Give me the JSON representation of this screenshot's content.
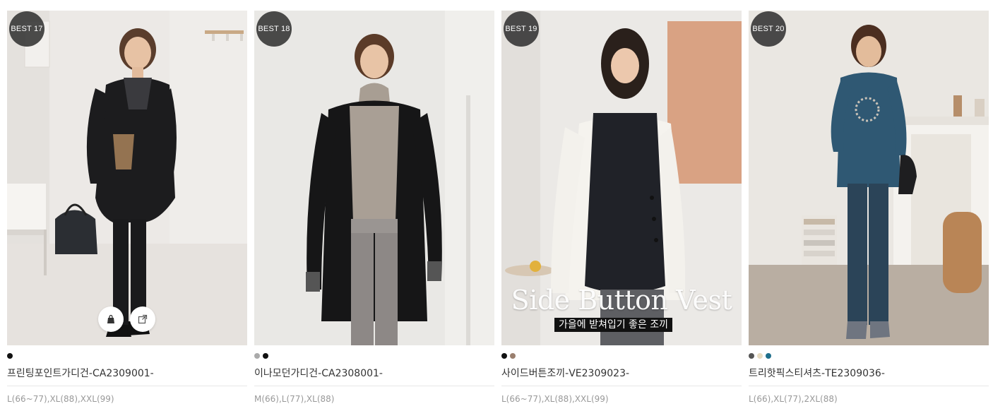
{
  "products": [
    {
      "badge": "BEST 17",
      "name": "프린팅포인트가디건-CA2309001-",
      "sizes": "L(66~77),XL(88),XXL(99)",
      "colors": [
        "#111111"
      ]
    },
    {
      "badge": "BEST 18",
      "name": "이나모던가디건-CA2308001-",
      "sizes": "M(66),L(77),XL(88)",
      "colors": [
        "#aaaaaa",
        "#111111"
      ]
    },
    {
      "badge": "BEST 19",
      "name": "사이드버튼조끼-VE2309023-",
      "sizes": "L(66~77),XL(88),XXL(99)",
      "colors": [
        "#111111",
        "#9a7f6e"
      ],
      "overlay": {
        "title": "Side Button Vest",
        "caption": "가을에 받쳐입기 좋은 조끼"
      }
    },
    {
      "badge": "BEST 20",
      "name": "트리핫픽스티셔츠-TE2309036-",
      "sizes": "L(66),XL(77),2XL(88)",
      "colors": [
        "#555555",
        "#e8dcc2",
        "#1f6f8b"
      ]
    }
  ],
  "icons": {
    "cart": "shopping-bag-icon",
    "open": "external-link-icon"
  }
}
